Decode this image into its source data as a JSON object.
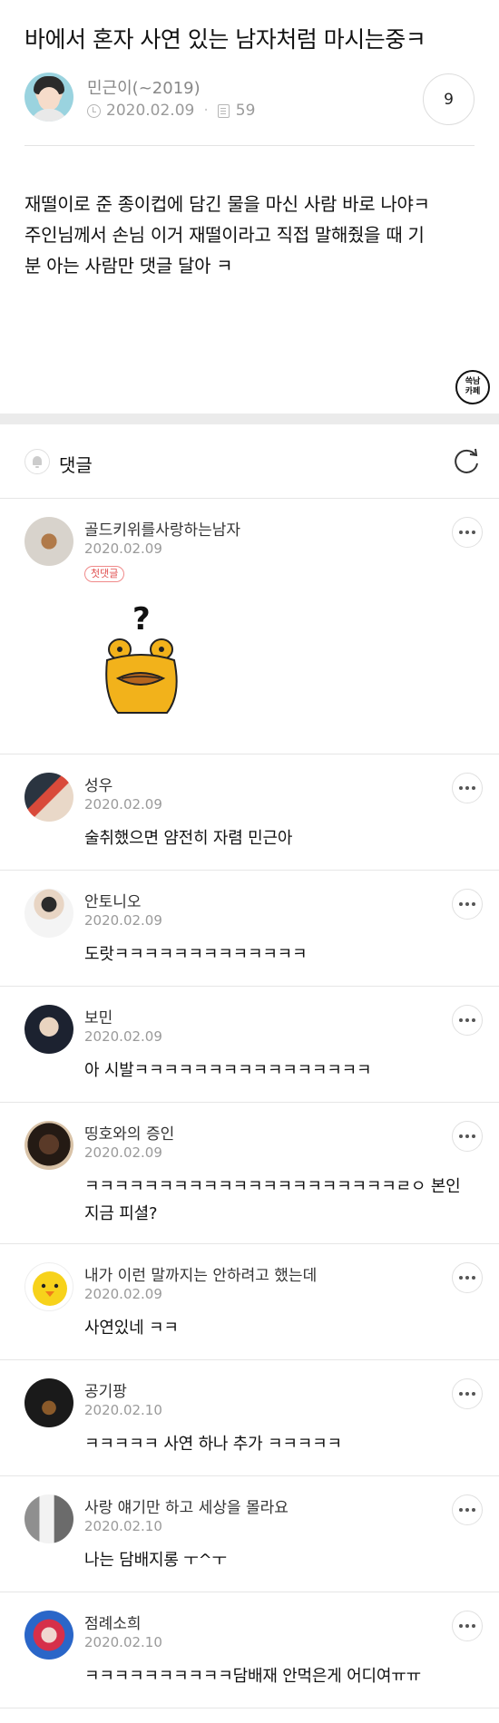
{
  "post": {
    "title": "바에서 혼자 사연 있는 남자처럼 마시는중ㅋ",
    "author": "민근이(~2019)",
    "date": "2020.02.09",
    "views": "59",
    "comment_count": "9",
    "body_lines": [
      "재떨이로 준 종이컵에 담긴 물을 마신 사람 바로 나야ㅋ",
      "주인님께서 손님 이거 재떨이라고 직접 말해줬을 때 기",
      "분 아는 사람만 댓글 달아 ㅋ"
    ],
    "cafe_logo": [
      "쓱남",
      "카페"
    ]
  },
  "comments_section": {
    "title": "댓글"
  },
  "comments": [
    {
      "name": "골드키위를사랑하는남자",
      "date": "2020.02.09",
      "badge": "첫댓글",
      "text": "",
      "avatar": "kiwi"
    },
    {
      "name": "성우",
      "date": "2020.02.09",
      "text": "술취했으면 얌전히 자렴 민근아",
      "avatar": "person-cap"
    },
    {
      "name": "안토니오",
      "date": "2020.02.09",
      "text": "도랏ㅋㅋㅋㅋㅋㅋㅋㅋㅋㅋㅋㅋㅋ",
      "avatar": "person-suit"
    },
    {
      "name": "보민",
      "date": "2020.02.09",
      "text": "아 시발ㅋㅋㅋㅋㅋㅋㅋㅋㅋㅋㅋㅋㅋㅋㅋㅋ",
      "avatar": "person-dark"
    },
    {
      "name": "띵호와의 증인",
      "date": "2020.02.09",
      "text": "ㅋㅋㅋㅋㅋㅋㅋㅋㅋㅋㅋㅋㅋㅋㅋㅋㅋㅋㅋㅋㅋㄹㅇ 본인 지금 피셜?",
      "avatar": "person-hood"
    },
    {
      "name": "내가 이런 말까지는 안하려고 했는데",
      "date": "2020.02.09",
      "text": "사연있네 ㅋㅋ",
      "avatar": "chick"
    },
    {
      "name": "공기팡",
      "date": "2020.02.10",
      "text": "ㅋㅋㅋㅋㅋ 사연 하나 추가 ㅋㅋㅋㅋㅋ",
      "avatar": "dark-scene"
    },
    {
      "name": "사랑 얘기만 하고 세상을 몰라요",
      "date": "2020.02.10",
      "text": "나는 담배지롱 ㅜ^ㅜ",
      "avatar": "couple"
    },
    {
      "name": "점례소희",
      "date": "2020.02.10",
      "text": "ㅋㅋㅋㅋㅋㅋㅋㅋㅋㅋ담배재 안먹은게 어디여ㅠㅠ",
      "avatar": "clown"
    }
  ]
}
